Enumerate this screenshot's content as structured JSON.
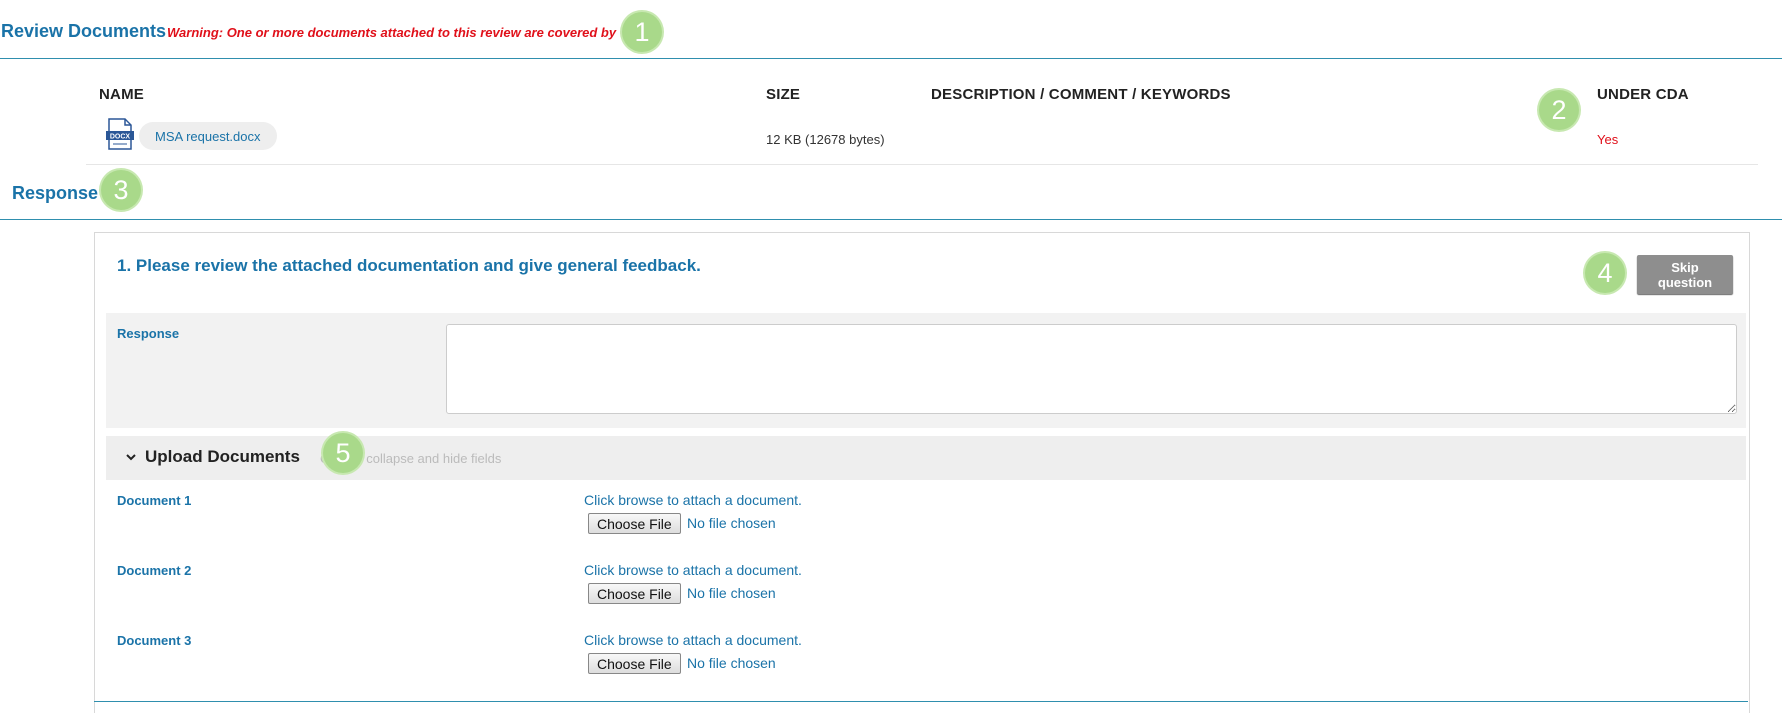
{
  "review": {
    "title": "Review Documents",
    "warning": "Warning: One or more documents attached to this review are covered by CDA."
  },
  "markers": [
    "1",
    "2",
    "3",
    "4",
    "5"
  ],
  "documents_table": {
    "headers": {
      "name": "NAME",
      "size": "SIZE",
      "description": "DESCRIPTION / COMMENT / KEYWORDS",
      "under_cda": "UNDER CDA"
    },
    "rows": [
      {
        "icon": "docx-file-icon",
        "icon_text": "DOCX",
        "name": "MSA request.docx",
        "size": "12 KB (12678 bytes)",
        "description": "",
        "under_cda": "Yes"
      }
    ]
  },
  "response_section": {
    "title": "Response",
    "question": "1. Please review the attached documentation and give general feedback.",
    "skip_label": "Skip question",
    "response_label": "Response",
    "response_value": ""
  },
  "upload": {
    "title": "Upload Documents",
    "hint": "Click to collapse and hide fields",
    "documents": [
      {
        "label": "Document 1",
        "hint": "Click browse to attach a document.",
        "button": "Choose File",
        "status": "No file chosen"
      },
      {
        "label": "Document 2",
        "hint": "Click browse to attach a document.",
        "button": "Choose File",
        "status": "No file chosen"
      },
      {
        "label": "Document 3",
        "hint": "Click browse to attach a document.",
        "button": "Choose File",
        "status": "No file chosen"
      }
    ]
  },
  "colors": {
    "accent": "#1a73a8",
    "warning": "#e0101a",
    "marker": "#a9d98a",
    "skip_button": "#8e8e8e"
  }
}
